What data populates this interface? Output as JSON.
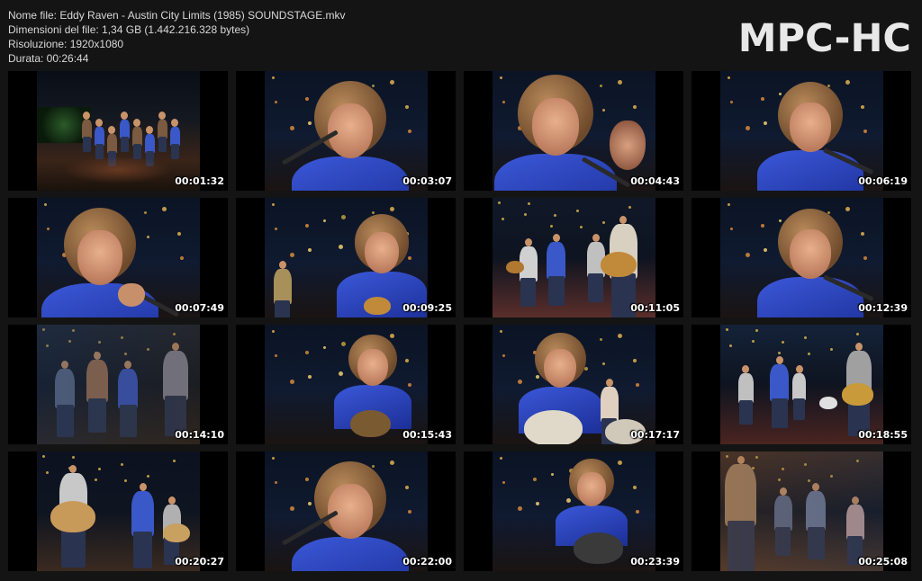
{
  "info": {
    "file_name": "Nome file: Eddy Raven - Austin City Limits (1985) SOUNDSTAGE.mkv",
    "file_size": "Dimensioni del file: 1,34 GB (1.442.216.328 bytes)",
    "resolution": "Risoluzione: 1920x1080",
    "duration": "Durata: 00:26:44"
  },
  "logo": "MPC-HC",
  "thumbnails": [
    {
      "time": "00:01:32",
      "scene": "wide-stage"
    },
    {
      "time": "00:03:07",
      "scene": "closeup-singer"
    },
    {
      "time": "00:04:43",
      "scene": "closeup-side"
    },
    {
      "time": "00:06:19",
      "scene": "closeup-singer-right"
    },
    {
      "time": "00:07:49",
      "scene": "closeup-mic-hand"
    },
    {
      "time": "00:09:25",
      "scene": "singer-with-guitarist"
    },
    {
      "time": "00:11:05",
      "scene": "band-medium"
    },
    {
      "time": "00:12:39",
      "scene": "closeup-singer-right"
    },
    {
      "time": "00:14:10",
      "scene": "band-dissolve"
    },
    {
      "time": "00:15:43",
      "scene": "singer-guitar-dissolve"
    },
    {
      "time": "00:17:17",
      "scene": "singer-guitar-front"
    },
    {
      "time": "00:18:55",
      "scene": "band-skyline"
    },
    {
      "time": "00:20:27",
      "scene": "band-guitarists"
    },
    {
      "time": "00:22:00",
      "scene": "closeup-singer"
    },
    {
      "time": "00:23:39",
      "scene": "singer-skyline"
    },
    {
      "time": "00:25:08",
      "scene": "band-dissolve-warm"
    }
  ]
}
